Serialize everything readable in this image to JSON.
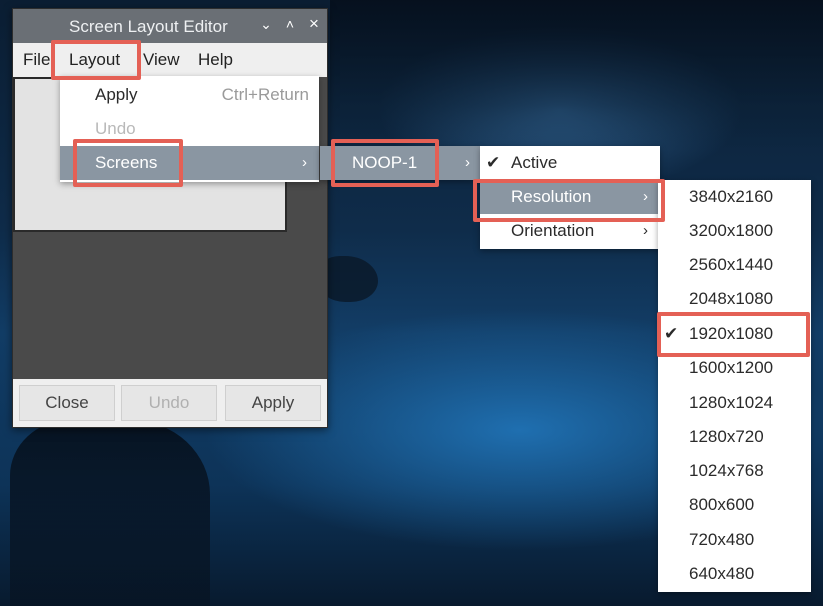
{
  "window": {
    "title": "Screen Layout Editor",
    "controls": [
      "⌄",
      "˄",
      "×"
    ],
    "menubar": [
      "File",
      "Layout",
      "View",
      "Help"
    ],
    "buttons": {
      "close": "Close",
      "undo": "Undo",
      "apply": "Apply"
    }
  },
  "layout_menu": {
    "apply": {
      "label": "Apply",
      "shortcut": "Ctrl+Return"
    },
    "undo": {
      "label": "Undo"
    },
    "screens": {
      "label": "Screens",
      "arrow": "›"
    }
  },
  "screens_menu": {
    "noop": {
      "label": "NOOP-1",
      "arrow": "›"
    }
  },
  "output_menu": {
    "active": {
      "check": "✔",
      "label": "Active"
    },
    "resolution": {
      "label": "Resolution",
      "arrow": "›"
    },
    "orientation": {
      "label": "Orientation",
      "arrow": "›"
    }
  },
  "resolution_menu": {
    "check": "✔",
    "items": [
      "3840x2160",
      "3200x1800",
      "2560x1440",
      "2048x1080",
      "1920x1080",
      "1600x1200",
      "1280x1024",
      "1280x720",
      "1024x768",
      "800x600",
      "720x480",
      "640x480"
    ],
    "selected": "1920x1080"
  },
  "colors": {
    "highlight": "#e46055",
    "menu_selected": "#8a96a2"
  }
}
